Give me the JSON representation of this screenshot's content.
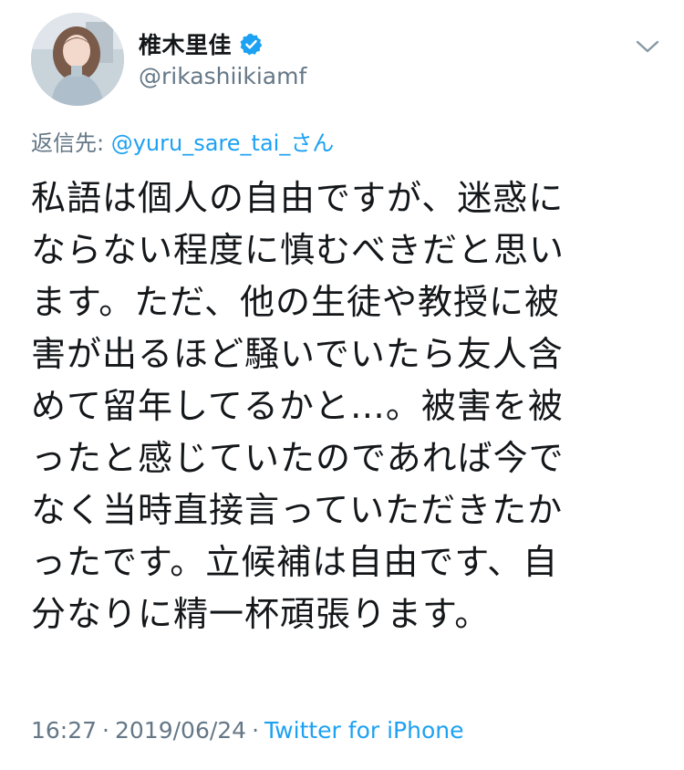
{
  "user": {
    "display_name": "椎木里佳",
    "handle": "@rikashiikiamf",
    "avatar_icon": "profile-photo",
    "verified_icon": "verified-badge-icon"
  },
  "reply": {
    "prefix": "返信先: ",
    "target": "@yuru_sare_tai_さん"
  },
  "tweet": {
    "text": "私語は個人の自由ですが、迷惑に\nならない程度に慎むべきだと思い\nます。ただ、他の生徒や教授に被\n害が出るほど騒いでいたら友人含\nめて留年してるかと…。被害を被\nったと感じていたのであれば今で\nなく当時直接言っていただきたか\nったです。立候補は自由です、自\n分なりに精一杯頑張ります。"
  },
  "meta": {
    "time": "16:27",
    "separator": "·",
    "date": "2019/06/24",
    "source": "Twitter for iPhone"
  },
  "colors": {
    "link": "#1da1f2",
    "muted": "#657786",
    "text": "#14171a",
    "verified": "#1da1f2"
  }
}
